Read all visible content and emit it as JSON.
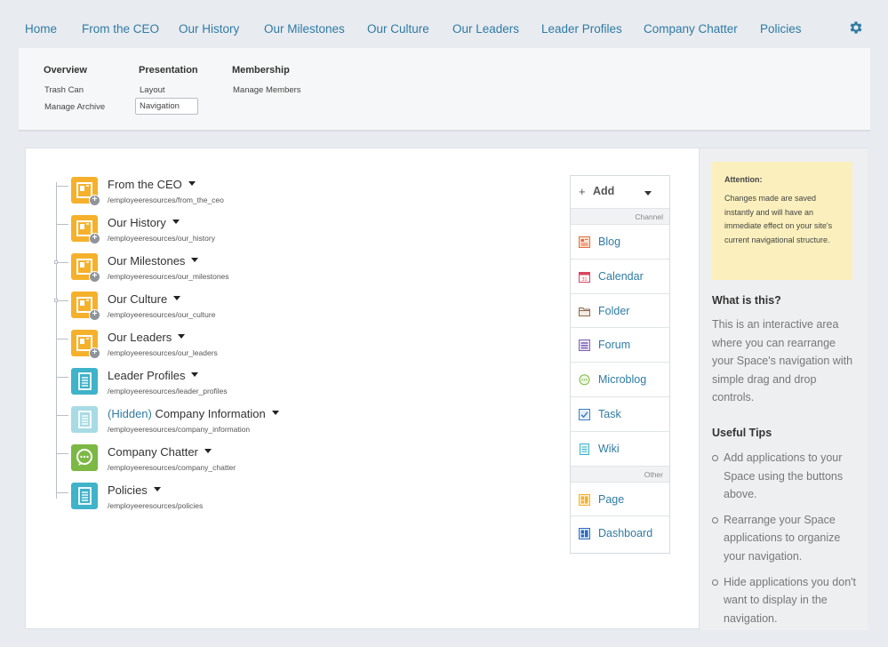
{
  "nav": {
    "items": [
      "Home",
      "From the CEO",
      "Our History",
      "Our Milestones",
      "Our Culture",
      "Our Leaders",
      "Leader Profiles",
      "Company Chatter",
      "Policies"
    ],
    "settings_icon": "gear-icon"
  },
  "admin": {
    "overview": {
      "title": "Overview",
      "links": [
        "Trash Can",
        "Manage Archive"
      ]
    },
    "presentation": {
      "title": "Presentation",
      "links": [
        "Layout",
        "Navigation"
      ]
    },
    "membership": {
      "title": "Membership",
      "links": [
        "Manage Members"
      ]
    }
  },
  "tree": [
    {
      "title": "From the CEO",
      "path": "/employeeresources/from_the_ceo",
      "icon": "page-icon",
      "color": "#f5b12b"
    },
    {
      "title": "Our History",
      "path": "/employeeresources/our_history",
      "icon": "page-icon",
      "color": "#f5b12b"
    },
    {
      "title": "Our Milestones",
      "path": "/employeeresources/our_milestones",
      "icon": "page-icon",
      "color": "#f5b12b"
    },
    {
      "title": "Our Culture",
      "path": "/employeeresources/our_culture",
      "icon": "page-icon",
      "color": "#f5b12b"
    },
    {
      "title": "Our Leaders",
      "path": "/employeeresources/our_leaders",
      "icon": "page-icon",
      "color": "#f5b12b"
    },
    {
      "title": "Leader Profiles",
      "path": "/employeeresources/leader_profiles",
      "icon": "wiki-icon",
      "color": "#3fb3c9"
    },
    {
      "hidden_prefix": "(Hidden)",
      "title": "Company Information",
      "path": "/employeeresources/company_information",
      "icon": "wiki-icon",
      "color": "#a7dbe5"
    },
    {
      "title": "Company Chatter",
      "path": "/employeeresources/company_chatter",
      "icon": "microblog-icon",
      "color": "#7cb844"
    },
    {
      "title": "Policies",
      "path": "/employeeresources/policies",
      "icon": "wiki-icon",
      "color": "#3fb3c9"
    }
  ],
  "add_panel": {
    "label": "Add",
    "channel_label": "Channel",
    "channel_items": [
      "Blog",
      "Calendar",
      "Folder",
      "Forum",
      "Microblog",
      "Task",
      "Wiki"
    ],
    "other_label": "Other",
    "other_items": [
      "Page",
      "Dashboard"
    ]
  },
  "sidebar": {
    "attention_title": "Attention:",
    "attention_body": "Changes made are saved instantly and will have an immediate effect on your site's current navigational structure.",
    "what_title": "What is this?",
    "what_body": "This is an interactive area where you can rearrange your Space's navigation with simple drag and drop controls.",
    "tips_title": "Useful Tips",
    "tips": [
      "Add applications to your Space using the buttons above.",
      "Rearrange your Space applications to organize your navigation.",
      "Hide applications you don't want to display in the navigation."
    ]
  },
  "colors": {
    "accent": "#2f7ba3",
    "page_orange": "#f5b12b",
    "wiki_teal": "#3fb3c9",
    "microblog_green": "#7cb844",
    "note_yellow": "#fbf0bd"
  }
}
